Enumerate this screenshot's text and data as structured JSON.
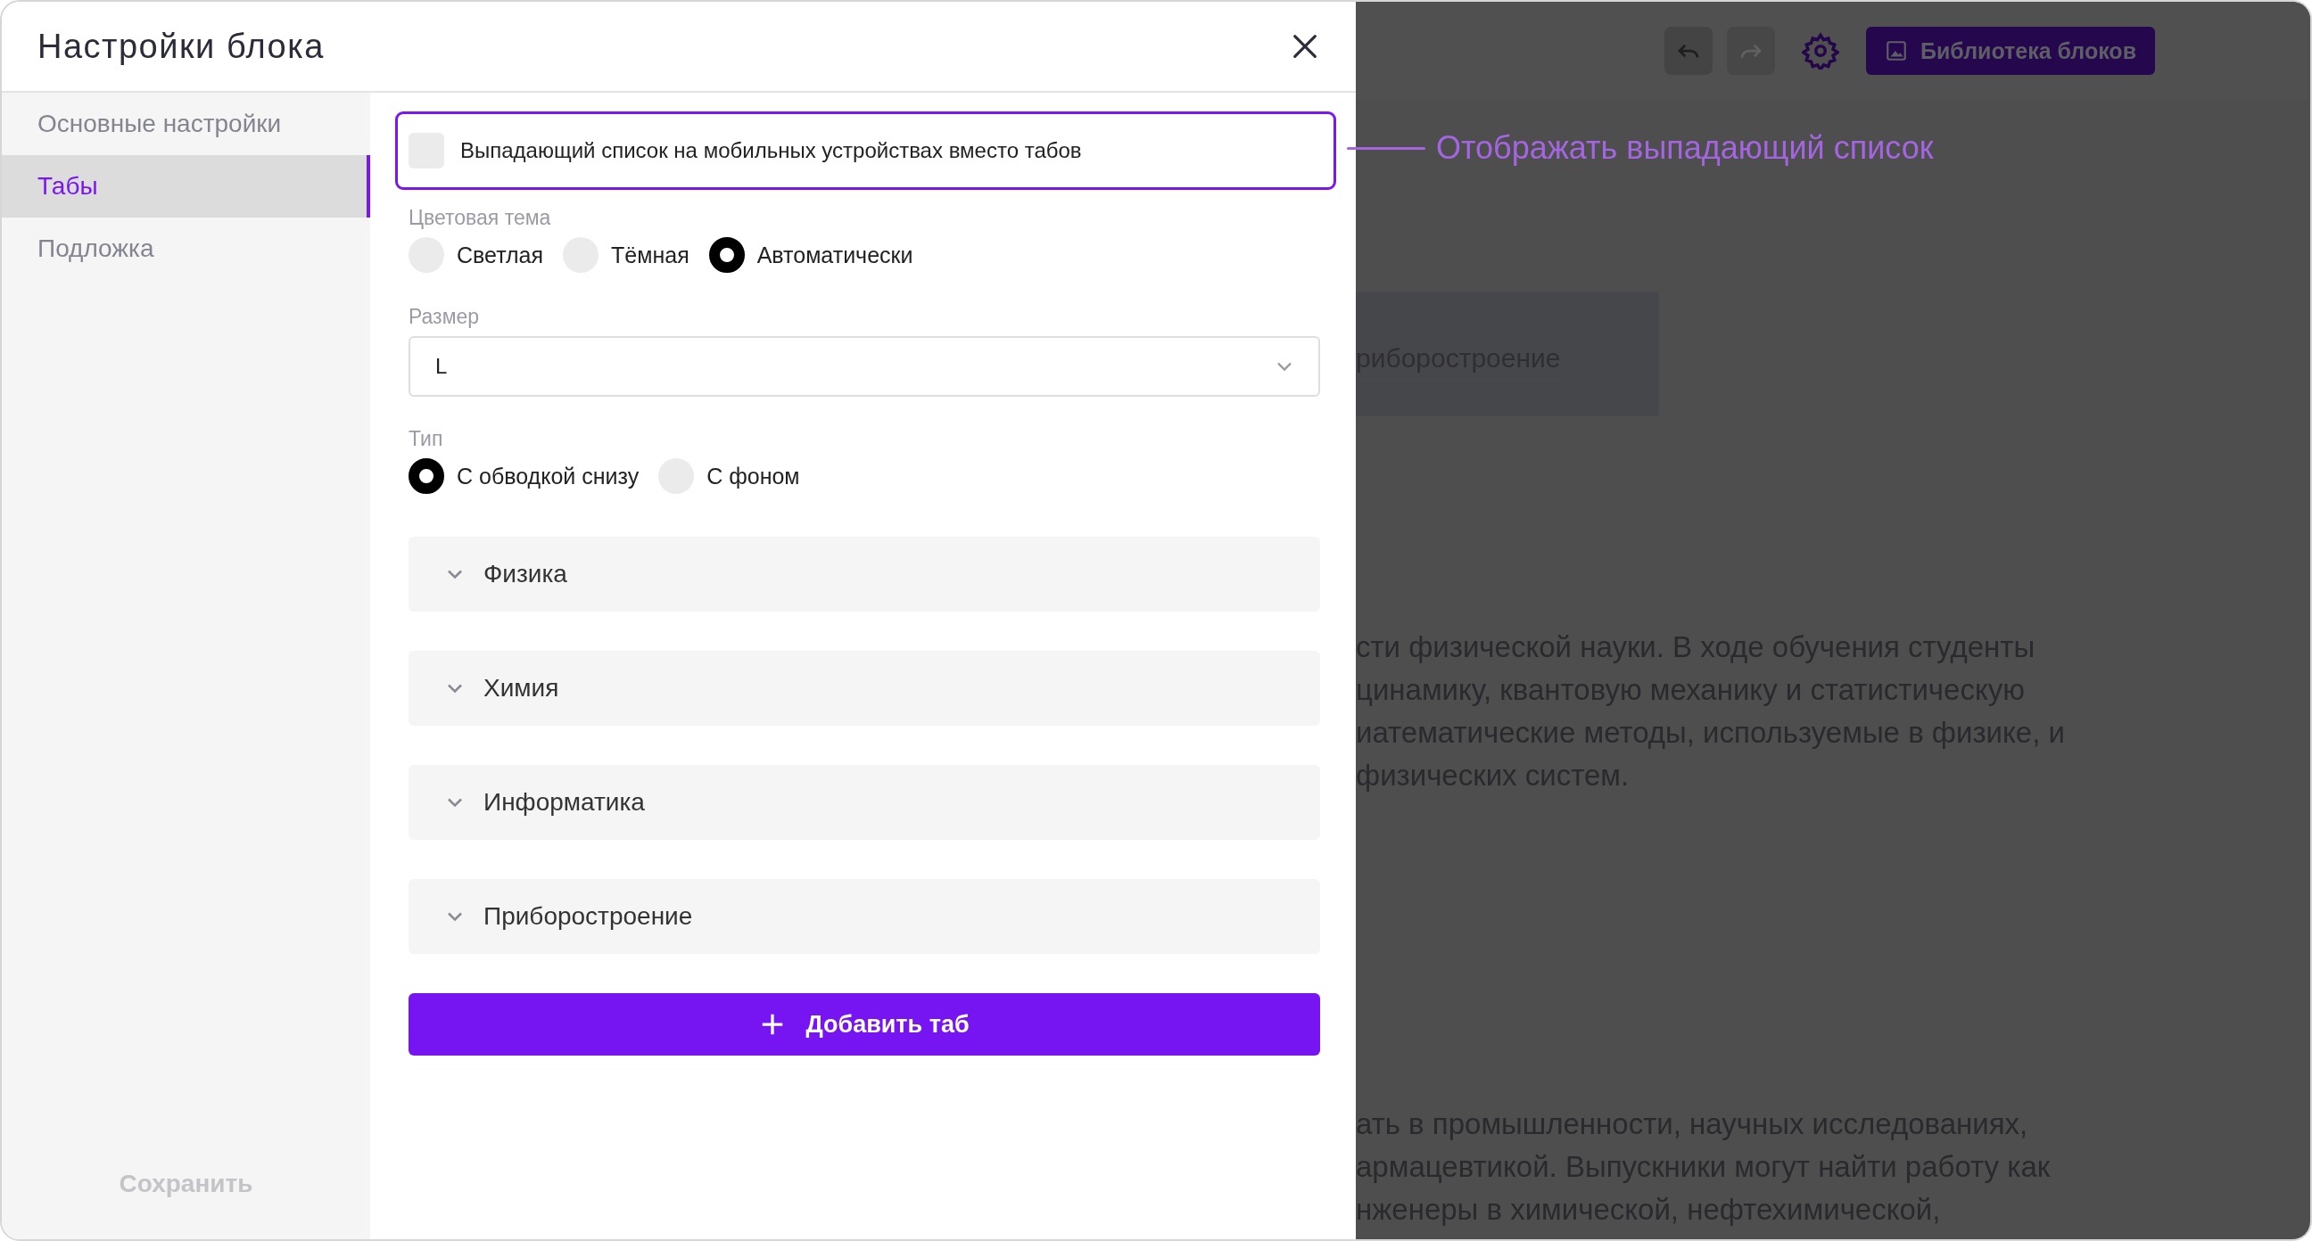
{
  "modal": {
    "title": "Настройки блока",
    "sidebar": {
      "items": [
        {
          "label": "Основные настройки",
          "selected": false
        },
        {
          "label": "Табы",
          "selected": true
        },
        {
          "label": "Подложка",
          "selected": false
        }
      ],
      "save_button": "Сохранить"
    },
    "form": {
      "dropdown_option": {
        "label": "Выпадающий список на мобильных устройствах вместо табов",
        "checked": false,
        "highlighted": true
      },
      "color_theme": {
        "label": "Цветовая тема",
        "options": [
          {
            "label": "Светлая",
            "selected": false
          },
          {
            "label": "Тёмная",
            "selected": false
          },
          {
            "label": "Автоматически",
            "selected": true
          }
        ]
      },
      "size": {
        "label": "Размер",
        "value": "L"
      },
      "type": {
        "label": "Тип",
        "options": [
          {
            "label": "С обводкой снизу",
            "selected": true
          },
          {
            "label": "С фоном",
            "selected": false
          }
        ]
      },
      "tabs": [
        {
          "label": "Физика",
          "expanded": false
        },
        {
          "label": "Химия",
          "expanded": false
        },
        {
          "label": "Информатика",
          "expanded": false
        },
        {
          "label": "Приборостроение",
          "expanded": false
        }
      ],
      "add_button": "Добавить таб"
    }
  },
  "annotation": {
    "text": "Отображать выпадающий список"
  },
  "background_page": {
    "toolbar": {
      "history_buttons": [
        {
          "kind": "undo",
          "disabled": false
        },
        {
          "kind": "redo",
          "disabled": true
        }
      ],
      "library_button": "Библиотека блоков"
    },
    "tab_card": {
      "label": "риборостроение"
    },
    "paragraphs": [
      "сти физической науки. В ходе обучения студенты\nцинамику, квантовую механику и статистическую\nиатематические методы, используемые в физике, и\nфизических систем.",
      "ать в промышленности, научных исследованиях,\nармацевтикой. Выпускники могут найти работу как\nнженеры в химической, нефтехимической,"
    ]
  }
}
